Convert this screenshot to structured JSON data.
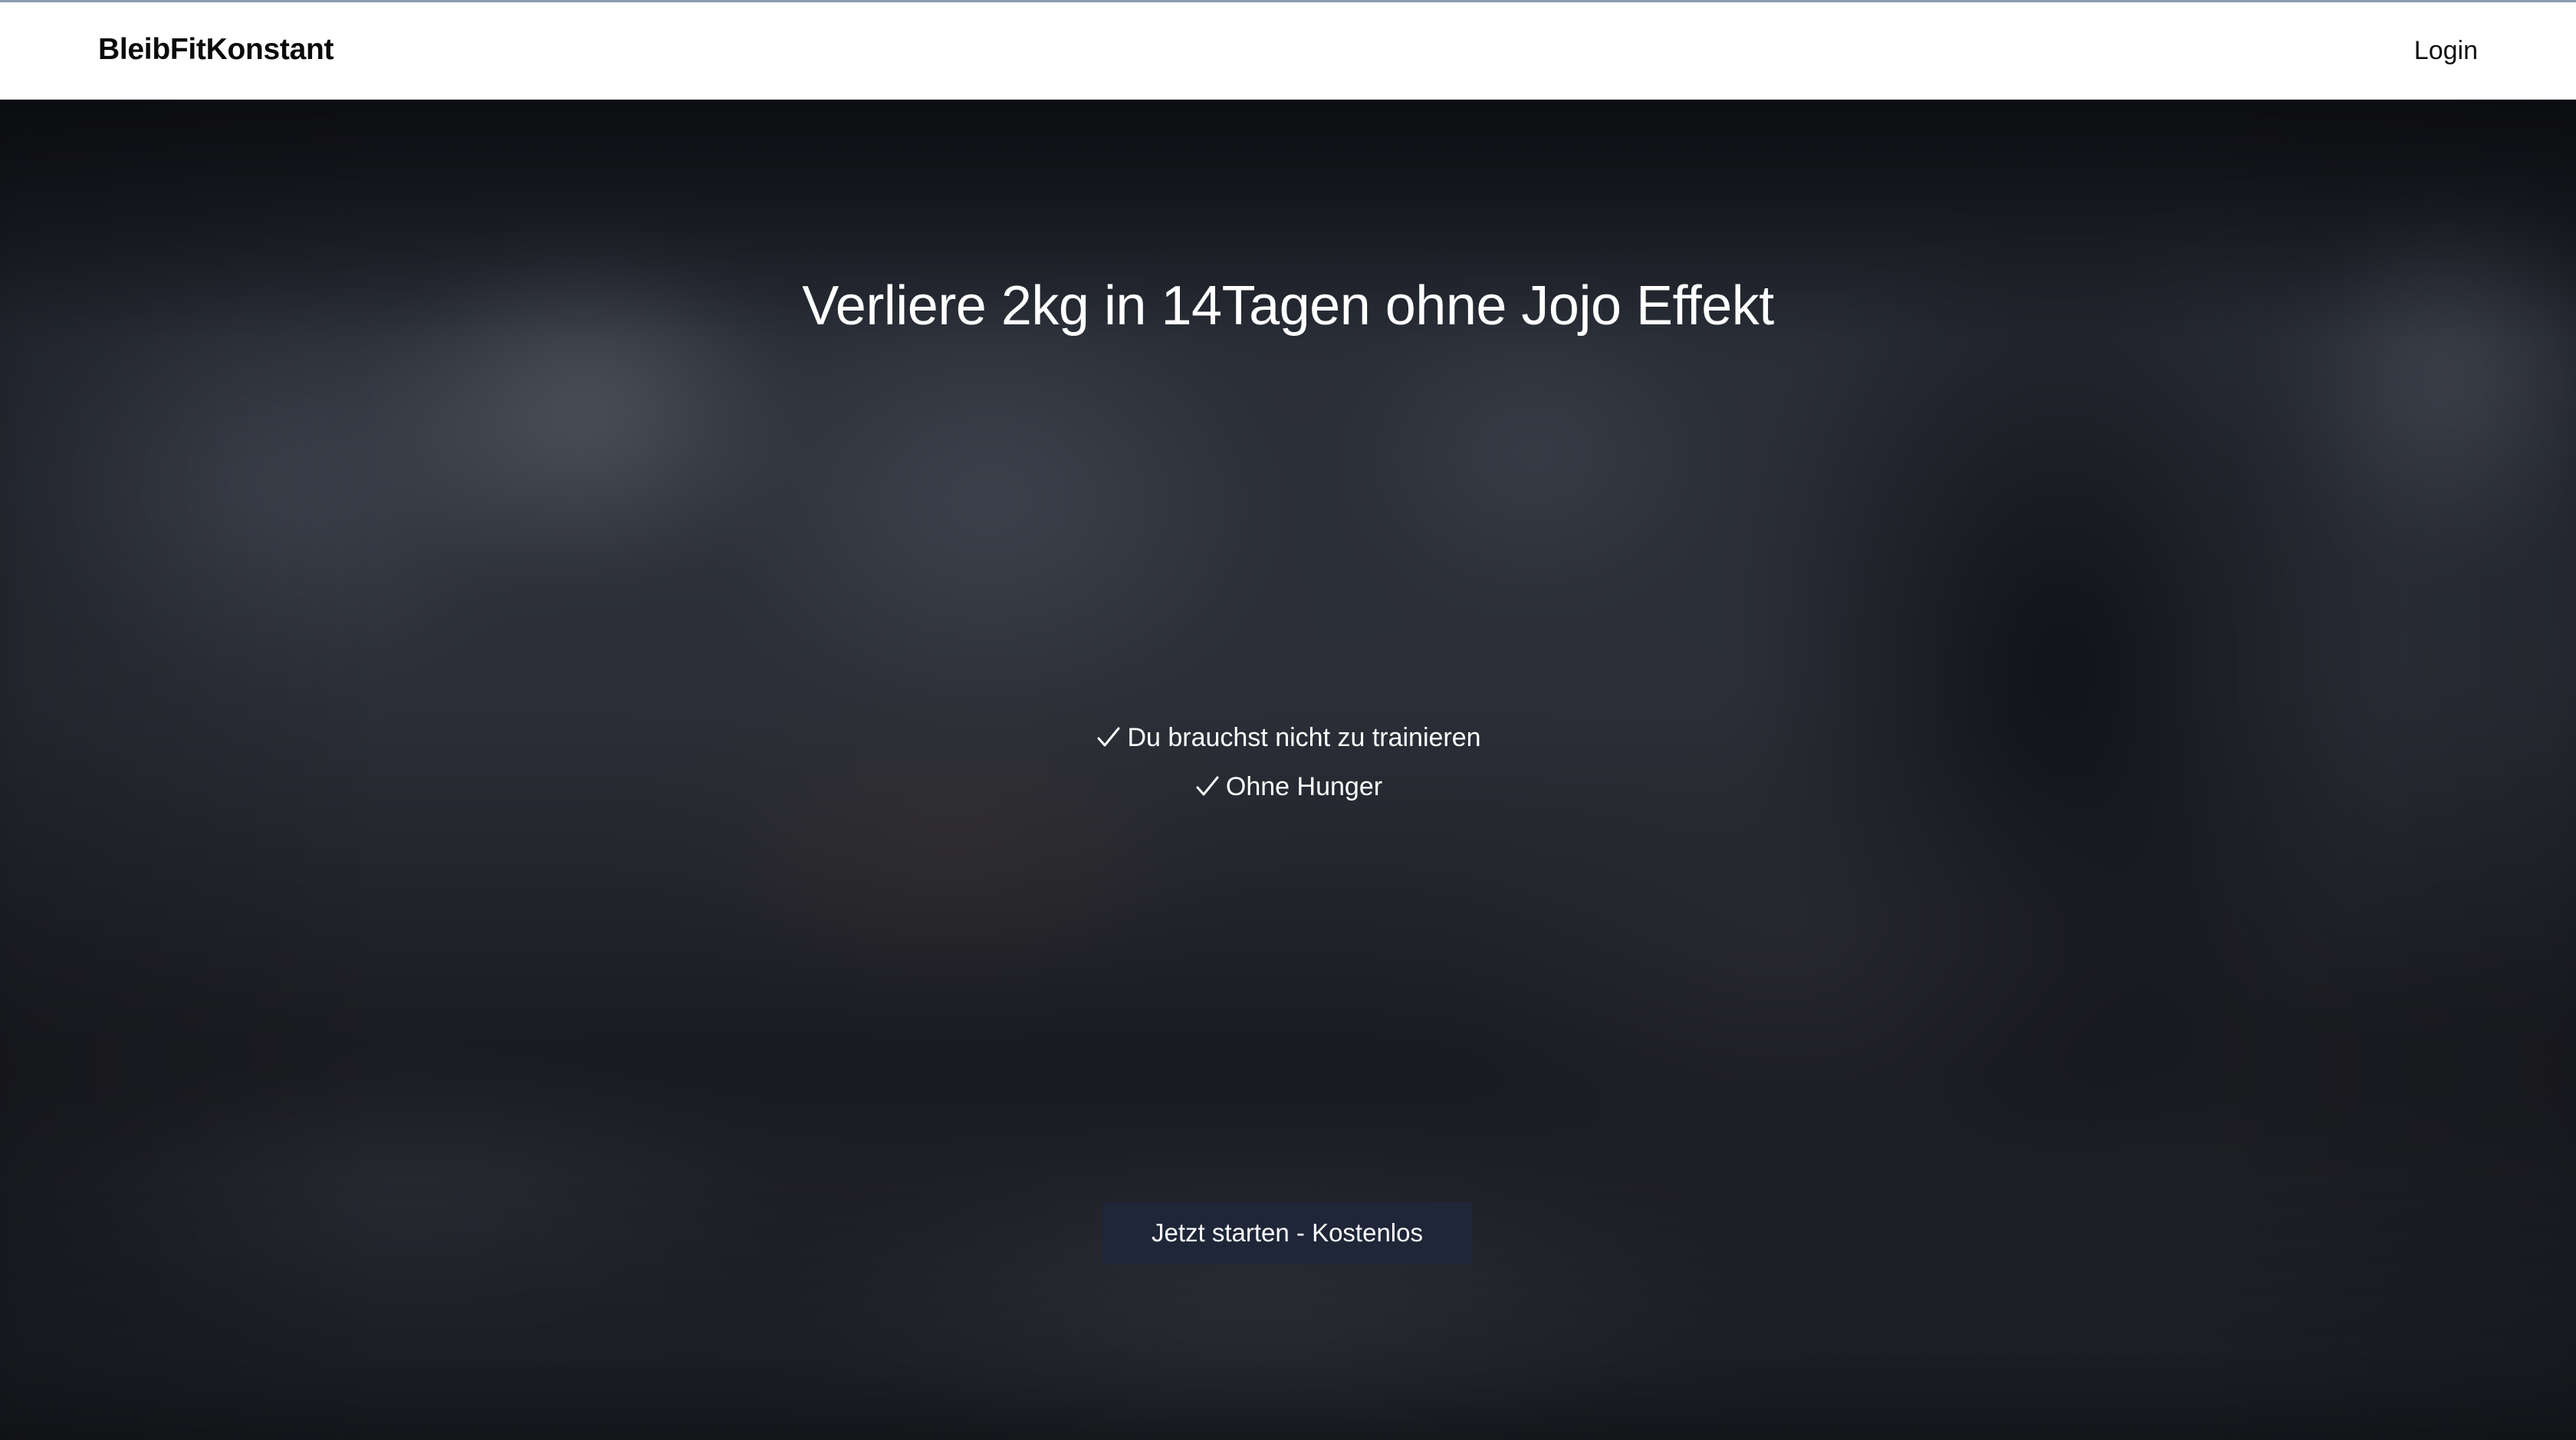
{
  "navbar": {
    "brand": "BleibFitKonstant",
    "login_label": "Login"
  },
  "hero": {
    "headline": "Verliere 2kg in 14Tagen ohne Jojo Effekt",
    "benefits": [
      {
        "icon": "check-icon",
        "label": "Du brauchst nicht zu trainieren"
      },
      {
        "icon": "check-icon",
        "label": "Ohne Hunger"
      }
    ],
    "cta_label": "Jetzt starten - Kostenlos"
  },
  "colors": {
    "navbar_bg": "#ffffff",
    "brand_text": "#0b0b0b",
    "hero_text": "#ffffff",
    "cta_bg": "#1e2638"
  }
}
